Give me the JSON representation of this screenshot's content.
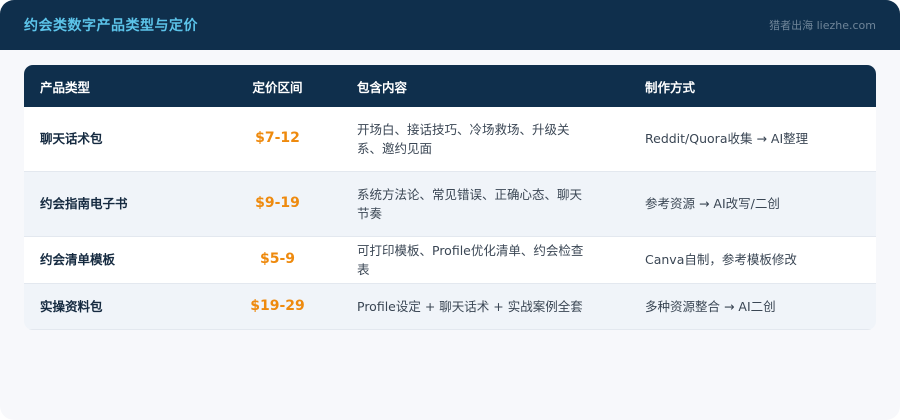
{
  "header": {
    "title": "约会类数字产品类型与定价",
    "brand": "猎者出海 liezhe.com"
  },
  "table": {
    "columns": [
      "产品类型",
      "定价区间",
      "包含内容",
      "制作方式"
    ],
    "rows": [
      {
        "type": "聊天话术包",
        "price": "$7-12",
        "content": "开场白、接话技巧、冷场救场、升级关系、邀约见面",
        "method": "Reddit/Quora收集 → AI整理"
      },
      {
        "type": "约会指南电子书",
        "price": "$9-19",
        "content": "系统方法论、常见错误、正确心态、聊天节奏",
        "method": "参考资源 → AI改写/二创"
      },
      {
        "type": "约会清单模板",
        "price": "$5-9",
        "content": "可打印模板、Profile优化清单、约会检查表",
        "method": "Canva自制，参考模板修改"
      },
      {
        "type": "实操资料包",
        "price": "$19-29",
        "content": "Profile设定 + 聊天话术 + 实战案例全套",
        "method": "多种资源整合 → AI二创"
      }
    ]
  },
  "colors": {
    "header_bg": "#0f2f4c",
    "title": "#5cc4ea",
    "price": "#ee8a0e",
    "row_alt": "#f0f4f9"
  }
}
